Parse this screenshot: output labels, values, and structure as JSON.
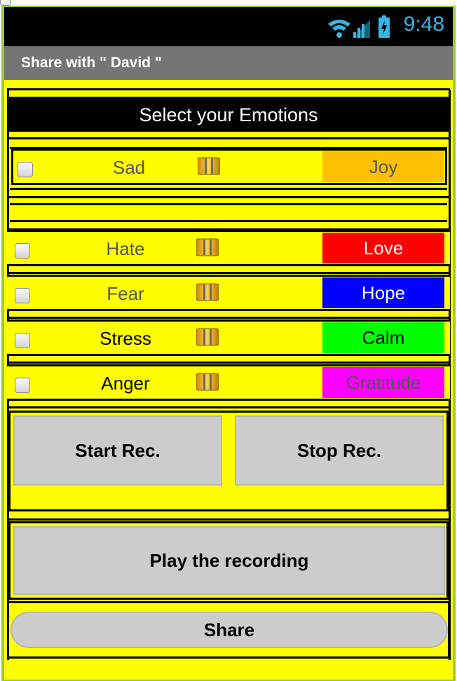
{
  "status_bar": {
    "time": "9:48",
    "icons": [
      "wifi-icon",
      "signal-icon",
      "battery-icon"
    ]
  },
  "title_bar": {
    "title": "Share with \" David \""
  },
  "header": {
    "title": "Select your Emotions"
  },
  "emotions": [
    {
      "negative": "Sad",
      "positive": "Joy",
      "positive_bg": "#ffc000",
      "positive_color": "#555555",
      "negative_color": "#555555"
    },
    {
      "negative": "Hate",
      "positive": "Love",
      "positive_bg": "#ff0000",
      "positive_color": "#ffffff",
      "negative_color": "#555555"
    },
    {
      "negative": "Fear",
      "positive": "Hope",
      "positive_bg": "#0000ff",
      "positive_color": "#ffffff",
      "negative_color": "#555555"
    },
    {
      "negative": "Stress",
      "positive": "Calm",
      "positive_bg": "#00ff00",
      "positive_color": "#000000",
      "negative_color": "#000000"
    },
    {
      "negative": "Anger",
      "positive": "Gratitude",
      "positive_bg": "#ff00ff",
      "positive_color": "#555555",
      "negative_color": "#000000"
    }
  ],
  "buttons": {
    "start_rec": "Start Rec.",
    "stop_rec": "Stop Rec.",
    "play": "Play the recording",
    "share": "Share"
  },
  "colors": {
    "app_background": "#ffff00",
    "frame": "#9acd32",
    "title_bar": "#757575",
    "button": "#cccccc",
    "status_time": "#33b5e5"
  }
}
